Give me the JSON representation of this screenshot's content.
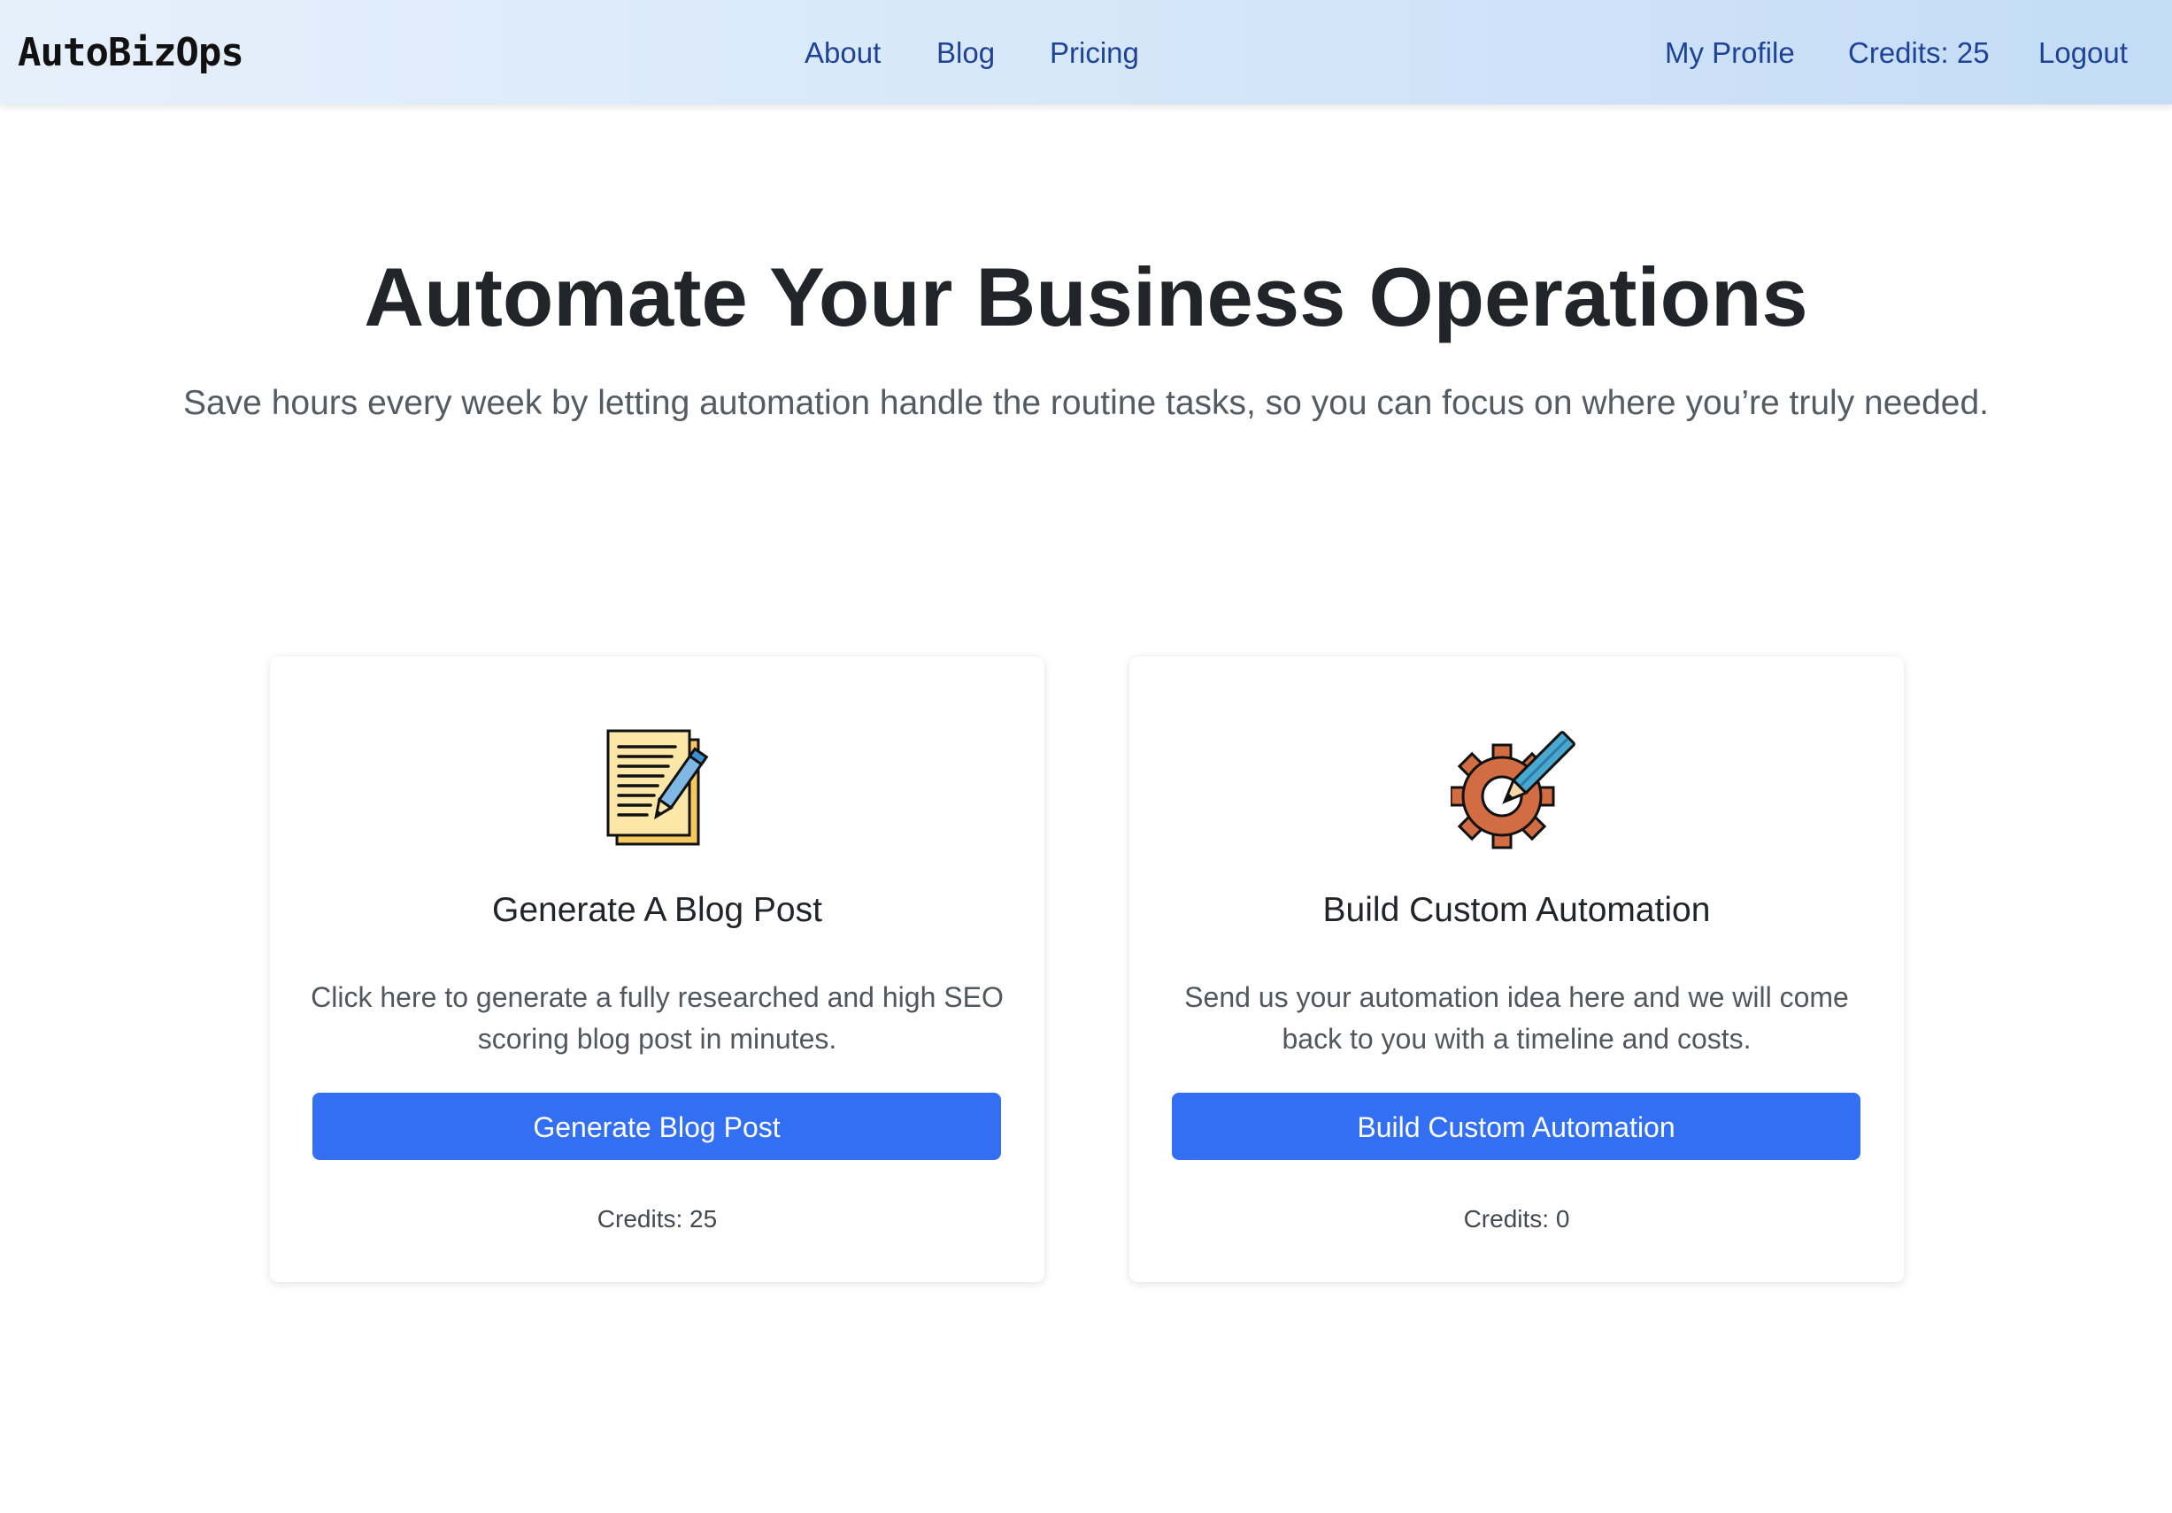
{
  "header": {
    "brand": "AutoBizOps",
    "nav": {
      "about": "About",
      "blog": "Blog",
      "pricing": "Pricing"
    },
    "user_nav": {
      "profile": "My Profile",
      "credits": "Credits: 25",
      "logout": "Logout"
    }
  },
  "hero": {
    "title": "Automate Your Business Operations",
    "subtitle": "Save hours every week by letting automation handle the routine tasks, so you can focus on where you’re truly needed."
  },
  "cards": [
    {
      "icon": "document-pencil-icon",
      "title": "Generate A Blog Post",
      "description": "Click here to generate a fully researched and high SEO scoring blog post in minutes.",
      "button_label": "Generate Blog Post",
      "credits": "Credits: 25"
    },
    {
      "icon": "gear-pencil-icon",
      "title": "Build Custom Automation",
      "description": "Send us your automation idea here and we will come back to you with a timeline and costs.",
      "button_label": "Build Custom Automation",
      "credits": "Credits: 0"
    }
  ],
  "colors": {
    "header_gradient_start": "#e6f0fb",
    "header_gradient_end": "#c4dcf6",
    "nav_link": "#1e4396",
    "primary_button": "#336ff2",
    "heading": "#212529",
    "muted_text": "#555b62"
  }
}
